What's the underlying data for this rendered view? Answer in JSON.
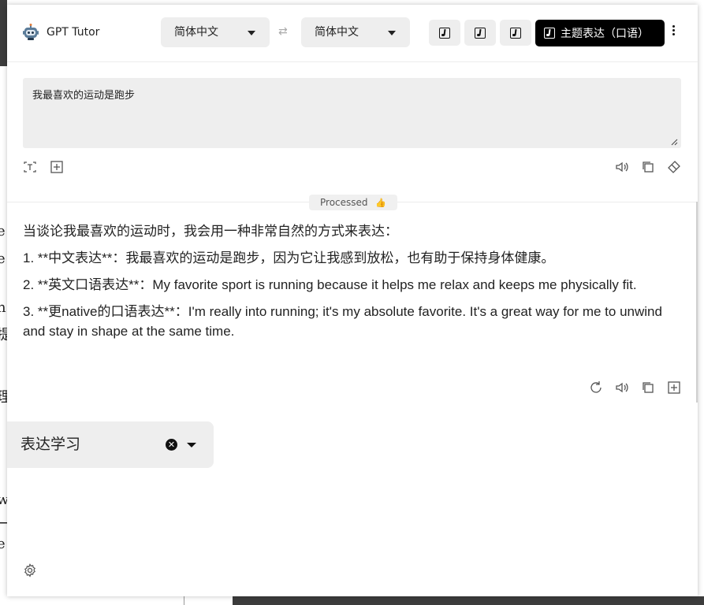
{
  "header": {
    "app_title": "GPT Tutor",
    "source_language": "简体中文",
    "target_language": "简体中文",
    "swap_icon": "⇄",
    "active_mode_label": "主题表达（口语）"
  },
  "input": {
    "text": "我最喜欢的运动是跑步"
  },
  "status": {
    "label": "Processed",
    "emoji": "👍"
  },
  "output": {
    "paragraphs": [
      "当谈论我最喜欢的运动时，我会用一种非常自然的方式来表达：",
      "1. **中文表达**：我最喜欢的运动是跑步，因为它让我感到放松，也有助于保持身体健康。",
      "2. **英文口语表达**：My favorite sport is running because it helps me relax and keeps me physically fit.",
      "3. **更native的口语表达**：I'm really into running; it's my absolute favorite. It's a great way for me to unwind and stay in shape at the same time."
    ]
  },
  "bottom_select": {
    "value": "表达学习"
  },
  "background_page": {
    "glyphs": [
      "e",
      "e",
      "n",
      "提",
      "理",
      "w",
      "一",
      "e"
    ]
  },
  "colors": {
    "accent": "#000000",
    "control_bg": "#eeeeee",
    "text": "#222222"
  }
}
